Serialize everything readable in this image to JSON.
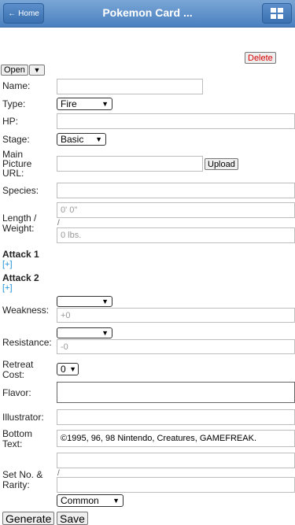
{
  "header": {
    "home_label": "Home",
    "title": "Pokemon Card ...",
    "home_icon": "left-arrow-icon",
    "menu_icon": "grid-icon"
  },
  "toolbar": {
    "delete_label": "Delete",
    "open_label": "Open"
  },
  "form": {
    "name_label": "Name:",
    "type_label": "Type:",
    "type_value": "Fire",
    "hp_label": "HP:",
    "stage_label": "Stage:",
    "stage_value": "Basic",
    "picture_label": [
      "Main",
      "Picture",
      "URL:"
    ],
    "upload_label": "Upload",
    "species_label": "Species:",
    "length_weight_label": [
      "Length /",
      "Weight:"
    ],
    "length_placeholder": "0' 0\"",
    "separator": "/",
    "weight_placeholder": "0 lbs.",
    "attack1_label": "Attack 1",
    "attack2_label": "Attack 2",
    "add_label": "[+]",
    "weakness_label": "Weakness:",
    "weakness_placeholder": "+0",
    "resistance_label": "Resistance:",
    "resistance_placeholder": "-0",
    "retreat_label": [
      "Retreat",
      "Cost:"
    ],
    "retreat_value": "0",
    "flavor_label": "Flavor:",
    "illustrator_label": "Illustrator:",
    "bottom_text_label": [
      "Bottom",
      "Text:"
    ],
    "bottom_text_value": "©1995, 96, 98 Nintendo, Creatures, GAMEFREAK.",
    "set_rarity_label": [
      "Set No. &",
      "Rarity:"
    ],
    "rarity_value": "Common",
    "generate_label": "Generate",
    "save_label": "Save"
  },
  "colors": {
    "header": "#4a80c0",
    "delete": "#d40000",
    "link": "#1e90d6"
  }
}
